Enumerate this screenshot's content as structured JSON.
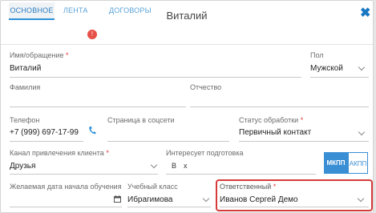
{
  "modal": {
    "title": "Виталий",
    "close_label": "✖"
  },
  "tabs": {
    "main": "ОСНОВНОЕ",
    "feed": "ЛЕНТА",
    "feed_badge": "!",
    "contracts": "ДОГОВОРЫ"
  },
  "form": {
    "name": {
      "label": "Имя/обращение",
      "required": "*",
      "value": "Виталий"
    },
    "gender": {
      "label": "Пол",
      "value": "Мужской"
    },
    "surname": {
      "label": "Фамилия",
      "value": ""
    },
    "patronymic": {
      "label": "Отчество",
      "value": ""
    },
    "phone": {
      "label": "Телефон",
      "value": "+7 (999) 697-17-99"
    },
    "social": {
      "label": "Страница в соцсети",
      "value": ""
    },
    "status": {
      "label": "Статус обработки",
      "required": "*",
      "value": "Первичный контакт"
    },
    "channel": {
      "label": "Канал привлечения клиента",
      "required": "*",
      "value": "Друзья"
    },
    "training": {
      "label": "Интересует подготовка",
      "chip_b": "B",
      "chip_x": "x"
    },
    "transmission": {
      "mkpp": "МКПП",
      "akpp": "АКПП"
    },
    "start_date": {
      "label": "Желаемая дата начала обучения",
      "value": ""
    },
    "class": {
      "label": "Учебный класс",
      "value": "Ибрагимова"
    },
    "responsible": {
      "label": "Ответственный",
      "required": "*",
      "value": "Иванов Сергей Демо"
    }
  },
  "colors": {
    "accent": "#2c8fd8",
    "highlight": "#d63b3b",
    "required": "#e03a3a"
  }
}
